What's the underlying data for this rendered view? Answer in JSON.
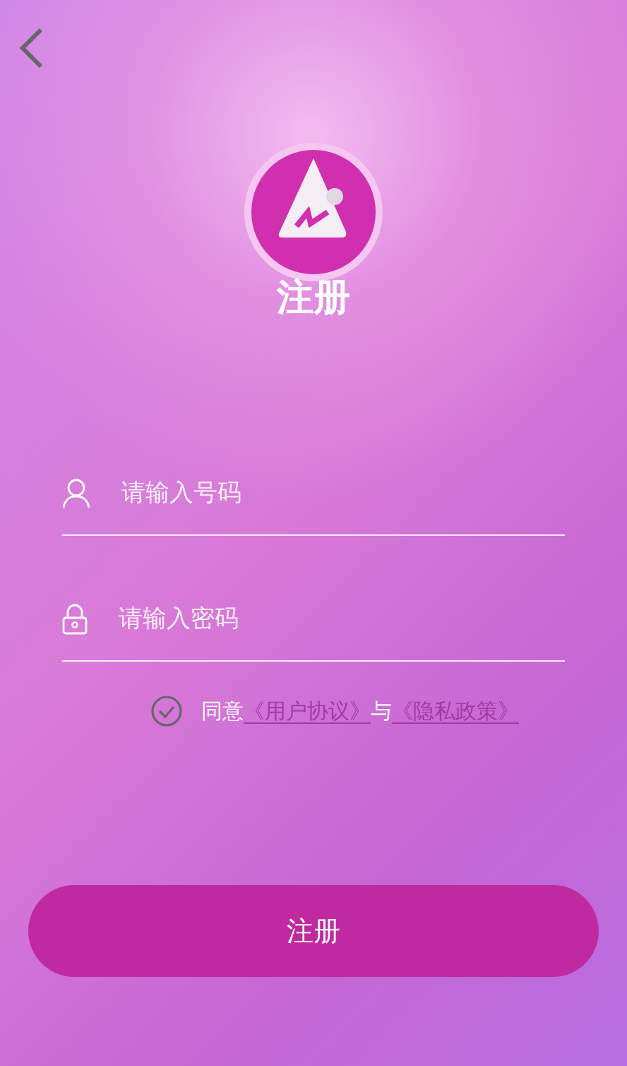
{
  "title": "注册",
  "fields": [
    {
      "kind": "phone",
      "placeholder": "请输入号码"
    },
    {
      "kind": "password",
      "placeholder": "请输入密码"
    }
  ],
  "agreement": {
    "checked": false,
    "parts": [
      {
        "kind": "text",
        "text": "同意"
      },
      {
        "kind": "link",
        "text": "《用户协议》"
      },
      {
        "kind": "text",
        "text": "与"
      },
      {
        "kind": "link",
        "text": "《隐私政策》"
      }
    ]
  },
  "submit_button": "注册"
}
